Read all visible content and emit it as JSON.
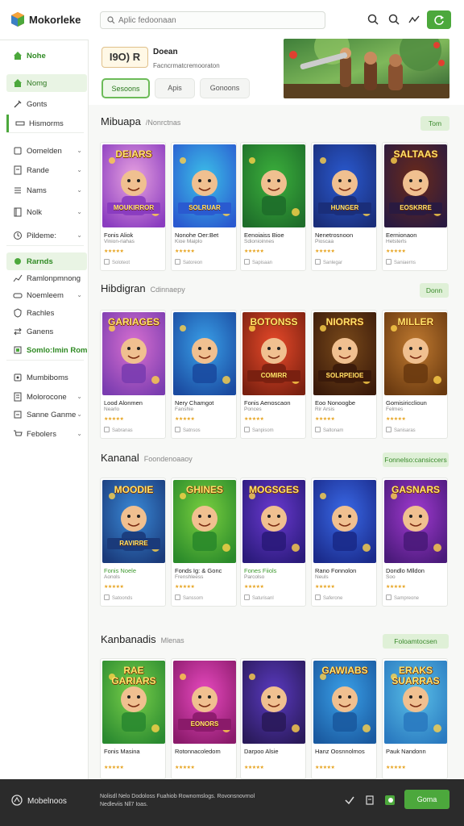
{
  "app": {
    "name": "Mokorleke",
    "accent": "#4ca83c",
    "dark": "#2b2b2b"
  },
  "search": {
    "placeholder": "Aplic fedoonaan"
  },
  "toolbar": {
    "icons": [
      "search-icon",
      "search-alt-icon",
      "chart-icon"
    ],
    "action_icon": "refresh-icon"
  },
  "sidebar": {
    "header": "Nohe",
    "items": [
      {
        "label": "Nomg",
        "icon": "home-icon",
        "state": "active"
      },
      {
        "label": "Gonts",
        "icon": "tools-icon"
      },
      {
        "label": "Hismorms",
        "icon": "bar-icon",
        "state": "bar"
      },
      {
        "label": "Oomelden",
        "icon": "square-icon",
        "chevron": true
      },
      {
        "label": "Rande",
        "icon": "doc-icon",
        "chevron": true
      },
      {
        "label": "Nams",
        "icon": "menu-icon",
        "chevron": true
      },
      {
        "label": "Nolk",
        "icon": "book-icon",
        "chevron": true
      },
      {
        "label": "Pildeme:",
        "icon": "clock-icon",
        "chevron": true
      },
      {
        "label": "Rarnds",
        "icon": "green-icon",
        "state": "light"
      },
      {
        "label": "Ramlonpmnong",
        "icon": "chart-line-icon"
      },
      {
        "label": "Noemleem",
        "icon": "gamepad-icon",
        "chevron": true
      },
      {
        "label": "Rachles",
        "icon": "shield-icon"
      },
      {
        "label": "Ganens",
        "icon": "swap-icon"
      },
      {
        "label": "Somlo:lmin Rom",
        "icon": "tag-icon",
        "state": "green"
      },
      {
        "label": "Mumbiboms",
        "icon": "square2-icon"
      },
      {
        "label": "Molorocone",
        "icon": "doc2-icon",
        "chevron": true
      },
      {
        "label": "Sanne Ganme",
        "icon": "list-icon",
        "chevron": true
      },
      {
        "label": "Febolers",
        "icon": "cart-icon",
        "chevron": true
      }
    ]
  },
  "hero": {
    "logo_text": "I9O) R",
    "title": "Doean",
    "subtitle": "Facncrmatcremooraton",
    "tabs": [
      "Sesoons",
      "Apis",
      "Gonoons"
    ]
  },
  "sections": [
    {
      "title": "Mibuapa",
      "subtitle": "/Nonrctnas",
      "button": "Tom",
      "cards": [
        {
          "title": "DEIARS",
          "tag": "MOUKIRROR",
          "name": "Fonis Aliok",
          "dev": "Vinion-riahas",
          "dl": "Soloteot"
        },
        {
          "title": "",
          "tag": "SOLRUAR",
          "name": "Nonohe Oer:Bet",
          "dev": "Kioe Maiplo",
          "dl": "Satoreon"
        },
        {
          "title": "",
          "tag": "",
          "name": "Eenoiaiss Bioe",
          "dev": "Sdionioinnes",
          "dl": "Sapisaan"
        },
        {
          "title": "",
          "tag": "HUNGER",
          "name": "Nenetrosnoon",
          "dev": "Pioscaa",
          "dl": "Sanlegar"
        },
        {
          "title": "SALTAAS",
          "tag": "EOSKRRE",
          "name": "Eernionaon",
          "dev": "Hetsterls",
          "dl": "Saniaerns"
        }
      ]
    },
    {
      "title": "Hibdigran",
      "subtitle": "Cdinnaepy",
      "button": "Donn",
      "cards": [
        {
          "title": "GARIAGES",
          "tag": "",
          "name": "Lood Alonmen",
          "dev": "Nearlo",
          "dl": "Sabranas"
        },
        {
          "title": "",
          "tag": "",
          "name": "Nery Chamgot",
          "dev": "Fanshie",
          "dl": "Satnsos"
        },
        {
          "title": "BOTONSS",
          "tag": "COMIRR",
          "name": "Fonis Aenoscaon",
          "dev": "Ponces",
          "dl": "Sanpisom"
        },
        {
          "title": "NIORRS",
          "tag": "SOLRPEIOE",
          "name": "Eoo Nonoogbe",
          "dev": "Rir Arsis",
          "dl": "Saltonam"
        },
        {
          "title": "MILLER",
          "tag": "",
          "name": "Gomisiricclioun",
          "dev": "Felmes",
          "dl": "Sanisaras"
        }
      ]
    },
    {
      "title": "Kananal",
      "subtitle": "Foondenoaaoy",
      "button": "Fonnelso:cansiccers",
      "cards": [
        {
          "title": "MOODIE",
          "tag": "RAVIRRE",
          "name": "Fonis Noele",
          "dev": "Aonols",
          "dl": "Satoonds",
          "green": true
        },
        {
          "title": "GHINES",
          "tag": "",
          "name": "Fonds Ig: & Gonc",
          "dev": "Frenshleess",
          "dl": "Sanssom"
        },
        {
          "title": "MOGSGES",
          "tag": "",
          "name": "Fones Fiiols",
          "dev": "Parcolso",
          "dl": "Saturisanl",
          "green": true
        },
        {
          "title": "",
          "tag": "",
          "name": "Rano Fonnolon",
          "dev": "Neuls",
          "dl": "Saferone"
        },
        {
          "title": "GASNARS",
          "tag": "",
          "name": "Dondlo Mlldon",
          "dev": "Soo",
          "dl": "Sampreone"
        }
      ]
    },
    {
      "title": "Kanbanadis",
      "subtitle": "Mlenas",
      "button": "Foloamtocsen",
      "cards": [
        {
          "title": "RAE GARIARS",
          "tag": "",
          "name": "Fonis Masina",
          "dev": "",
          "dl": ""
        },
        {
          "title": "",
          "tag": "EONORS",
          "name": "Rotonnacoledom",
          "dev": "",
          "dl": ""
        },
        {
          "title": "",
          "tag": "",
          "name": "Darpoo Alsie",
          "dev": "",
          "dl": ""
        },
        {
          "title": "GAWIABS",
          "tag": "",
          "name": "Hanz Oosnnolmos",
          "dev": "",
          "dl": ""
        },
        {
          "title": "ERAKS SUARRAS",
          "tag": "",
          "name": "Pauk Nandonn",
          "dev": "",
          "dl": ""
        }
      ]
    }
  ],
  "bottom": {
    "brand": "Mobelnoos",
    "text": "Nolisdl Nelo Dodoloss Fuahiob Rownomslogs. Rovonsnovrnol Nedleviis Nll7 Ioas.",
    "button": "Goma"
  }
}
